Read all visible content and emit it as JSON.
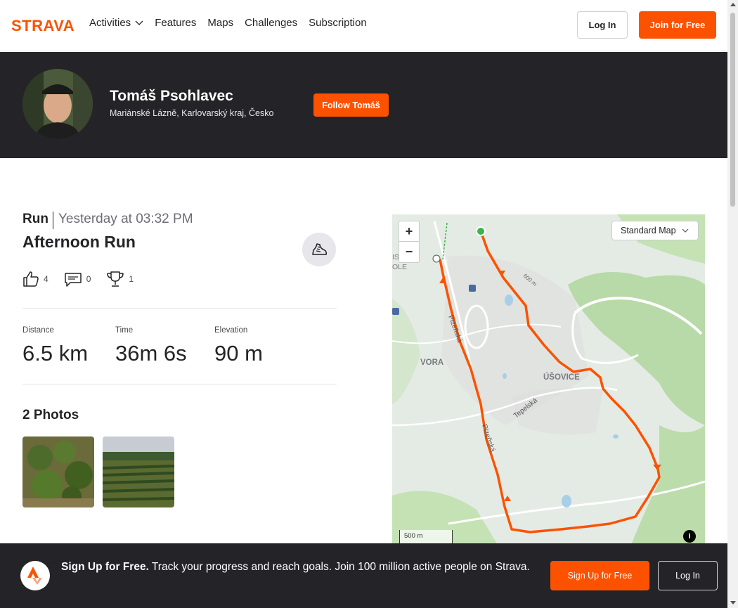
{
  "nav": {
    "brand": "STRAVA",
    "links": [
      "Activities",
      "Features",
      "Maps",
      "Challenges",
      "Subscription"
    ],
    "login_label": "Log In",
    "join_label": "Join for Free"
  },
  "athlete": {
    "name": "Tomáš Psohlavec",
    "location": "Mariánské Lázně, Karlovarský kraj, Česko",
    "follow_label": "Follow Tomáš"
  },
  "activity": {
    "type": "Run",
    "date": "Yesterday at 03:32 PM",
    "title": "Afternoon Run",
    "kudos": "4",
    "comments": "0",
    "achievements": "1",
    "stats": [
      {
        "label": "Distance",
        "value": "6.5 km"
      },
      {
        "label": "Time",
        "value": "36m 6s"
      },
      {
        "label": "Elevation",
        "value": "90 m"
      }
    ],
    "photos_title": "2 Photos"
  },
  "map": {
    "zoom_in": "+",
    "zoom_out": "−",
    "style_select": "Standard Map",
    "scale": "500 m",
    "info": "i",
    "labels": {
      "vora": "VORA",
      "usovice": "ÚŠOVICE",
      "plzenska1": "Plzeňská",
      "plzenska2": "Plzeňská",
      "tepelska": "Tepelská",
      "is_ole": "IS\nOLE",
      "contour": "600 m"
    }
  },
  "signup_bar": {
    "headline": "Sign Up for Free.",
    "text": " Track your progress and reach goals. Join 100 million active people on Strava.",
    "signup_label": "Sign Up for Free",
    "login_label": "Log In"
  },
  "colors": {
    "brand_orange": "#fc5200",
    "dark_bg": "#242428",
    "route": "#fc5200"
  }
}
